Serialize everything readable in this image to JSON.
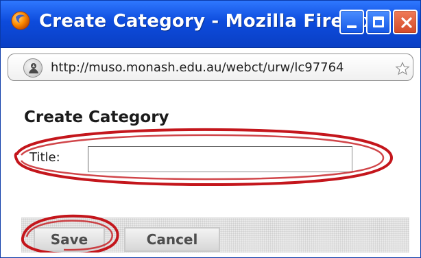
{
  "window": {
    "title": "Create Category - Mozilla Firefox",
    "url": "http://muso.monash.edu.au/webct/urw/lc97764",
    "buttons": {
      "minimize": "",
      "maximize": "",
      "close": ""
    }
  },
  "form": {
    "heading": "Create Category",
    "title_label": "Title:",
    "title_value": "",
    "title_placeholder": ""
  },
  "actions": {
    "save_label": "Save",
    "cancel_label": "Cancel"
  },
  "icons": {
    "browser_icon": "firefox-icon",
    "site_identity_icon": "site-identity-icon",
    "bookmark_icon": "star-icon",
    "minimize_icon": "minimize-icon",
    "maximize_icon": "maximize-icon",
    "close_icon": "close-icon"
  },
  "colors": {
    "titlebar_blue": "#0d4bdc",
    "annotation_red": "#c4161c"
  }
}
